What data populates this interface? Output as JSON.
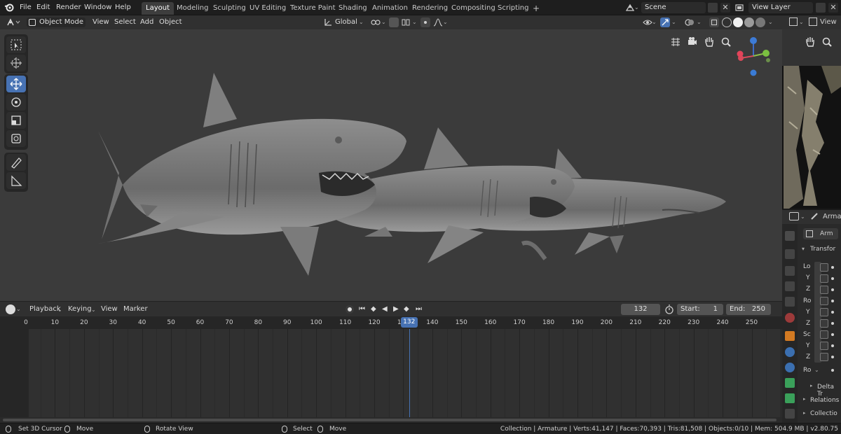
{
  "menubar": {
    "items": [
      "File",
      "Edit",
      "Render",
      "Window",
      "Help"
    ],
    "workspaces": [
      "Layout",
      "Modeling",
      "Sculpting",
      "UV Editing",
      "Texture Paint",
      "Shading",
      "Animation",
      "Rendering",
      "Compositing",
      "Scripting"
    ],
    "active_workspace": "Layout",
    "add_tab": "+",
    "scene": "Scene",
    "view_layer": "View Layer"
  },
  "viewport_header": {
    "mode": "Object Mode",
    "menus": [
      "View",
      "Select",
      "Add",
      "Object"
    ],
    "orientation": "Global"
  },
  "gizmo": {
    "x": "X",
    "y": "Y",
    "z": "Z"
  },
  "timeline": {
    "menus": [
      "Playback",
      "Keying",
      "View",
      "Marker"
    ],
    "current_frame": "132",
    "start_label": "Start:",
    "start": "1",
    "end_label": "End:",
    "end": "250",
    "ticks": [
      "0",
      "10",
      "20",
      "30",
      "40",
      "50",
      "60",
      "70",
      "80",
      "90",
      "100",
      "110",
      "120",
      "130",
      "140",
      "150",
      "160",
      "170",
      "180",
      "190",
      "200",
      "210",
      "220",
      "230",
      "240",
      "250"
    ]
  },
  "image_editor": {
    "view_label": "View"
  },
  "properties": {
    "object_name": "Arma",
    "data_name": "Arm",
    "transform_label": "Transfor",
    "rows": [
      "Lo",
      "Y",
      "Z",
      "Ro",
      "Y",
      "Z",
      "Sc",
      "Y",
      "Z"
    ],
    "rot_mode": "Ro",
    "delta_label": "Delta Tr",
    "relations_label": "Relations",
    "collections_label": "Collectio"
  },
  "status": {
    "set_cursor": "Set 3D Cursor",
    "move": "Move",
    "rotate": "Rotate View",
    "select": "Select",
    "move2": "Move",
    "info": "Collection | Armature | Verts:41,147 | Faces:70,393 | Tris:81,508 | Objects:0/10 | Mem: 504.9 MB | v2.80.75"
  },
  "colors": {
    "accent": "#4772b3",
    "viewport_bg": "#3b3b3b",
    "playhead": "#4772b3"
  },
  "playhead_frame": 132
}
